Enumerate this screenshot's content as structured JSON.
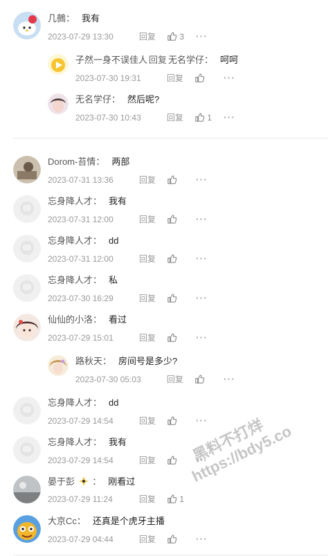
{
  "ui": {
    "reply_label": "回复",
    "colon": "："
  },
  "comments": [
    {
      "user": "几鵺",
      "text": "我有",
      "time": "2023-07-29 13:30",
      "likes": "3"
    },
    {
      "user": "子然一身不误佳人",
      "reply_to": "无名学仔",
      "text": "呵呵",
      "time": "2023-07-30 19:31",
      "likes": ""
    },
    {
      "user": "无名学仔",
      "text": "然后呢?",
      "time": "2023-07-30 10:43",
      "likes": "1"
    },
    {
      "user": "Dorom-苔情",
      "text": "两部",
      "time": "2023-07-31 13:36",
      "likes": ""
    },
    {
      "user": "忘身降人才",
      "text": "我有",
      "time": "2023-07-31 12:00",
      "likes": ""
    },
    {
      "user": "忘身降人才",
      "text": "dd",
      "time": "2023-07-31 12:00",
      "likes": ""
    },
    {
      "user": "忘身降人才",
      "text": "私",
      "time": "2023-07-30 16:29",
      "likes": ""
    },
    {
      "user": "仙仙的小洛",
      "text": "看过",
      "time": "2023-07-29 15:01",
      "likes": ""
    },
    {
      "user": "路秋天",
      "text": "房间号是多少?",
      "time": "2023-07-30 05:03",
      "likes": ""
    },
    {
      "user": "忘身降人才",
      "text": "dd",
      "time": "2023-07-29 14:54",
      "likes": ""
    },
    {
      "user": "忘身降人才",
      "text": "我有",
      "time": "2023-07-29 14:54",
      "likes": ""
    },
    {
      "user": "晏于彭",
      "text": "刚看过",
      "time": "2023-07-29 11:24",
      "likes": "1"
    },
    {
      "user": "大京Cc",
      "text": "还真是个虎牙主播",
      "time": "2023-07-29 04:44",
      "likes": ""
    }
  ],
  "watermark": {
    "line1": "黑料不打烊",
    "line2": "https://bdy5.co"
  },
  "colors": {
    "muted": "#999999",
    "divider": "#e8e8e8"
  }
}
